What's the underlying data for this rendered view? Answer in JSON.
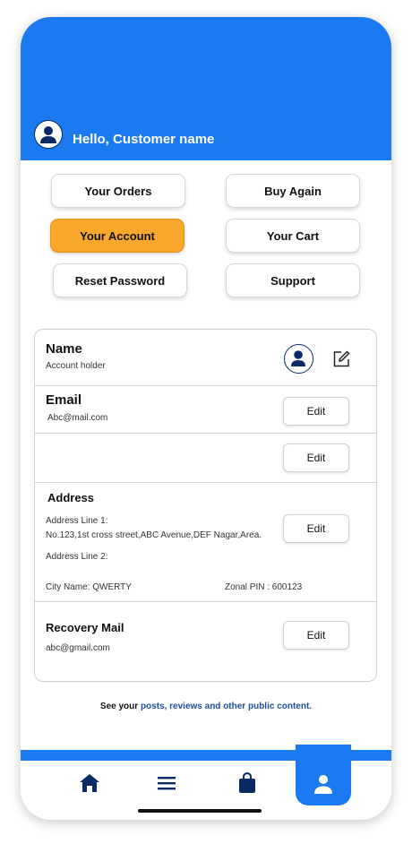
{
  "header": {
    "greeting": "Hello, Customer name",
    "accent_color": "#1c7af0"
  },
  "quick_actions": [
    {
      "label": "Your Orders",
      "active": false
    },
    {
      "label": "Buy Again",
      "active": false
    },
    {
      "label": "Your Account",
      "active": true
    },
    {
      "label": "Your Cart",
      "active": false
    },
    {
      "label": "Reset Password",
      "active": false
    },
    {
      "label": "Support",
      "active": false
    }
  ],
  "account": {
    "name": {
      "title": "Name",
      "subtitle": "Account holder",
      "avatar_icon": "user-icon",
      "edit_icon": "edit-icon"
    },
    "email": {
      "title": "Email",
      "value": "Abc@mail.com",
      "edit_label": "Edit"
    },
    "blank": {
      "edit_label": "Edit"
    },
    "address": {
      "title": "Address",
      "line1_label": "Address Line 1:",
      "line1_value": "No.123,1st cross street,ABC Avenue,DEF Nagar,Area.",
      "line2_label": "Address Line 2:",
      "city": "City Name: QWERTY",
      "zonal_pin": "Zonal PIN : 600123",
      "edit_label": "Edit"
    },
    "recovery": {
      "title": "Recovery Mail",
      "value": "abc@gmail.com",
      "edit_label": "Edit"
    }
  },
  "footer_note": {
    "prefix": "See your ",
    "link": "posts, reviews and other public content."
  },
  "nav": [
    {
      "icon": "home-icon"
    },
    {
      "icon": "menu-icon"
    },
    {
      "icon": "shopping-bag-icon"
    },
    {
      "icon": "user-icon",
      "active": true
    }
  ]
}
